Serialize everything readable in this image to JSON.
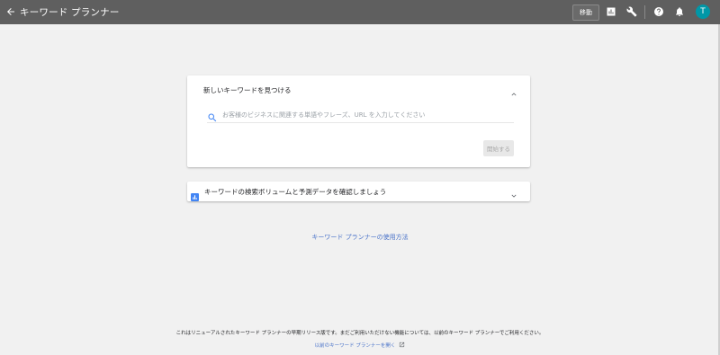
{
  "app": {
    "title": "キーワード プランナー",
    "goto_label": "移動",
    "avatar_initial": "T",
    "avatar_color": "#0097a7",
    "toolbar_icons": [
      "bar-chart-icon",
      "wrench-icon",
      "help-icon",
      "bell-icon"
    ]
  },
  "find_keywords": {
    "header": "新しいキーワードを見つける",
    "search_placeholder": "お客様のビジネスに関連する単語やフレーズ、URL を入力してください",
    "start_label": "開始する"
  },
  "forecast": {
    "label": "キーワードの検索ボリュームと予測データを確認しましょう"
  },
  "footer": {
    "howto_link": "キーワード プランナーの使用方法",
    "notice": "これはリニューアルされたキーワード プランナーの早期リリース版です。まだご利用いただけない機能については、以前のキーワード プランナーでご利用ください。",
    "old_planner_link": "以前のキーワード プランナーを開く"
  },
  "colors": {
    "topbar": "#5f5f5f",
    "link": "#4a73c9",
    "chart_icon": "#4285f4"
  }
}
